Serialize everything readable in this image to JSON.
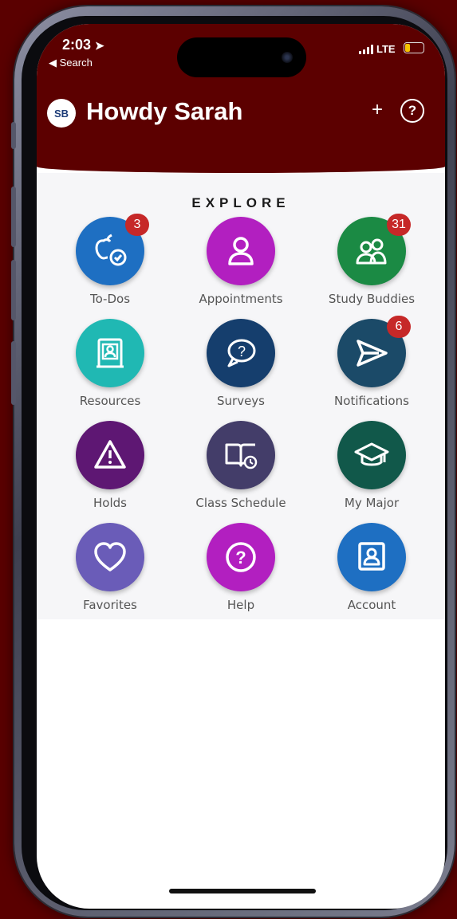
{
  "status_bar": {
    "time": "2:03",
    "back_label": "◀ Search",
    "network": "LTE"
  },
  "header": {
    "avatar_initials": "SB",
    "title": "Howdy Sarah",
    "add_label": "+",
    "help_label": "?"
  },
  "section_title": "EXPLORE",
  "tiles": [
    {
      "label": "To-Dos",
      "icon": "apple-check-icon",
      "color": "#1e6fc2",
      "badge": "3"
    },
    {
      "label": "Appointments",
      "icon": "person-icon",
      "color": "#b21fc0"
    },
    {
      "label": "Study Buddies",
      "icon": "group-icon",
      "color": "#1b8a44",
      "badge": "31"
    },
    {
      "label": "Resources",
      "icon": "contact-card-icon",
      "color": "#20b8b3"
    },
    {
      "label": "Surveys",
      "icon": "question-bubble-icon",
      "color": "#153e6d"
    },
    {
      "label": "Notifications",
      "icon": "paper-plane-icon",
      "color": "#1b4a68",
      "badge": "6"
    },
    {
      "label": "Holds",
      "icon": "warning-icon",
      "color": "#5e1773"
    },
    {
      "label": "Class Schedule",
      "icon": "book-clock-icon",
      "color": "#433d69"
    },
    {
      "label": "My Major",
      "icon": "graduation-cap-icon",
      "color": "#11584a"
    },
    {
      "label": "Favorites",
      "icon": "heart-icon",
      "color": "#6a5cb8"
    },
    {
      "label": "Help",
      "icon": "question-circle-icon",
      "color": "#b21fc0"
    },
    {
      "label": "Account",
      "icon": "account-card-icon",
      "color": "#1e6fc2"
    }
  ]
}
